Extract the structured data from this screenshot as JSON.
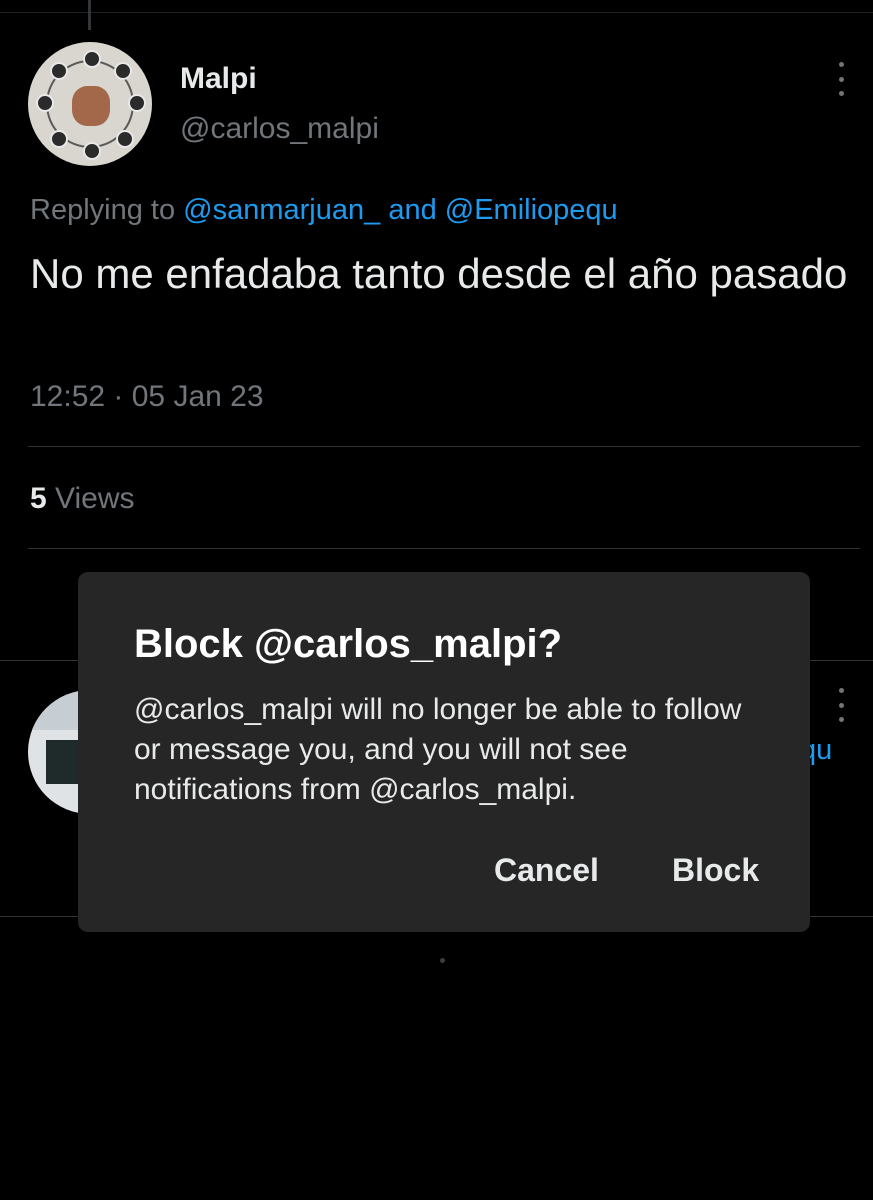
{
  "tweet": {
    "author_name": "Malpi",
    "author_handle": "@carlos_malpi",
    "replying_prefix": "Replying to ",
    "replying_mention_1": "@sanmarjuan_",
    "replying_and": " and ",
    "replying_mention_2": "@Emiliopequ",
    "text": "No me enfadaba tanto desde el año pasado",
    "timestamp": "12:52 · 05 Jan 23",
    "views_count": "5",
    "views_label": " Views"
  },
  "next_tweet": {
    "peek_text": "qu"
  },
  "dialog": {
    "title": "Block @carlos_malpi?",
    "body": "@carlos_malpi will no longer be able to follow or message you, and you will not see notifications from @carlos_malpi.",
    "cancel_label": "Cancel",
    "block_label": "Block"
  },
  "icons": {
    "more": "more-vertical-icon"
  },
  "colors": {
    "background": "#000000",
    "text_primary": "#e7e9ea",
    "text_secondary": "#71767b",
    "link": "#1d9bf0",
    "dialog_bg": "#262626",
    "divider": "#2f3336"
  }
}
